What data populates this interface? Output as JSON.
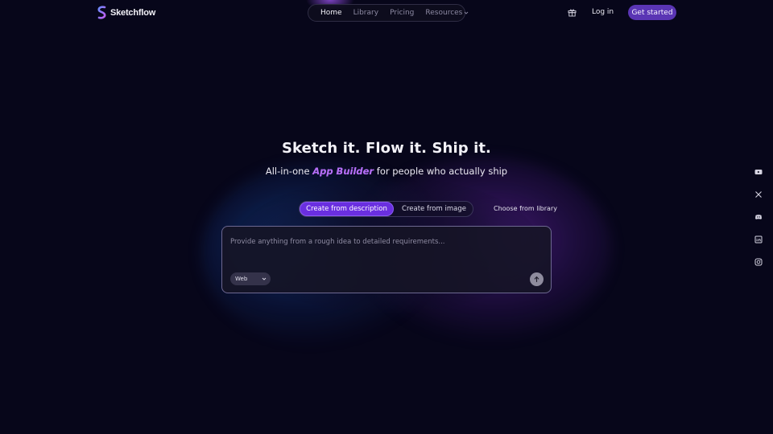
{
  "brand": {
    "name": "Sketchflow"
  },
  "nav": {
    "items": [
      {
        "label": "Home",
        "active": true
      },
      {
        "label": "Library",
        "active": false
      },
      {
        "label": "Pricing",
        "active": false
      },
      {
        "label": "Resources",
        "active": false,
        "has_dropdown": true
      }
    ]
  },
  "header": {
    "gift_icon": "gift-icon",
    "login_label": "Log in",
    "cta_label": "Get started"
  },
  "hero": {
    "title": "Sketch it. Flow it. Ship it.",
    "subtitle_prefix": "All-in-one",
    "subtitle_accent": "App Builder",
    "subtitle_suffix": "for people who actually ship"
  },
  "tabs": {
    "items": [
      {
        "label": "Create from description",
        "selected": true
      },
      {
        "label": "Create from image",
        "selected": false
      }
    ],
    "library_link": "Choose from library"
  },
  "prompt": {
    "value": "",
    "placeholder": "Provide anything from a rough idea to detailed requirements...",
    "platform_selected": "Web",
    "send_icon": "arrow-up-icon"
  },
  "social": [
    "youtube-icon",
    "x-icon",
    "discord-icon",
    "linkedin-icon",
    "instagram-icon"
  ],
  "colors": {
    "background": "#07061a",
    "accent": "#6a2fe0",
    "cta": "#5a35b4",
    "accent_text": "#b46df5"
  }
}
